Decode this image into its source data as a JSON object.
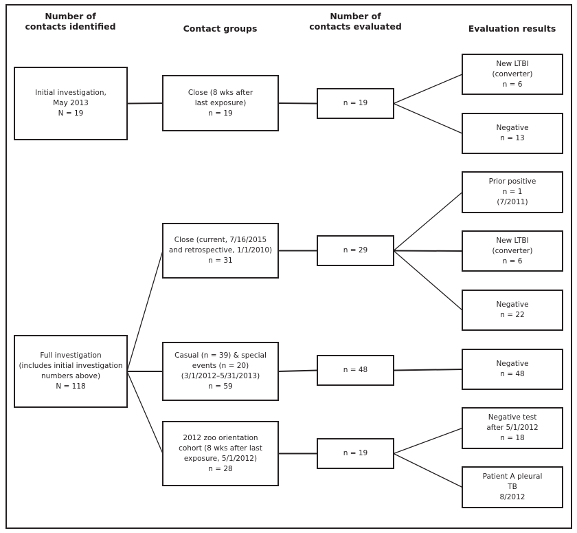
{
  "headers": {
    "identified": "Number of\ncontacts identified",
    "groups": "Contact groups",
    "evaluated": "Number of\ncontacts evaluated",
    "results": "Evaluation results"
  },
  "identified": [
    {
      "id": "initial",
      "text": "Initial investigation,\nMay 2013\nN = 19"
    },
    {
      "id": "full",
      "text": "Full investigation\n(includes initial investigation\nnumbers above)\nN = 118"
    }
  ],
  "groups": [
    {
      "id": "close-initial",
      "text": "Close (8 wks after\nlast exposure)\nn = 19"
    },
    {
      "id": "close-full",
      "text": "Close (current, 7/16/2015\nand retrospective, 1/1/2010)\nn = 31"
    },
    {
      "id": "casual",
      "text": "Casual (n = 39) & special\nevents (n = 20)\n(3/1/2012–5/31/2013)\nn = 59"
    },
    {
      "id": "zoo-cohort",
      "text": "2012 zoo orientation\ncohort (8 wks after last\nexposure, 5/1/2012)\nn = 28"
    }
  ],
  "evaluated": [
    {
      "id": "eval-close-initial",
      "text": "n = 19"
    },
    {
      "id": "eval-close-full",
      "text": "n = 29"
    },
    {
      "id": "eval-casual",
      "text": "n = 48"
    },
    {
      "id": "eval-zoo",
      "text": "n = 19"
    }
  ],
  "results": [
    {
      "id": "r1",
      "text": "New LTBI\n(converter)\nn = 6"
    },
    {
      "id": "r2",
      "text": "Negative\nn = 13"
    },
    {
      "id": "r3",
      "text": "Prior positive\nn = 1\n(7/2011)"
    },
    {
      "id": "r4",
      "text": "New LTBI\n(converter)\nn = 6"
    },
    {
      "id": "r5",
      "text": "Negative\nn = 22"
    },
    {
      "id": "r6",
      "text": "Negative\nn = 48"
    },
    {
      "id": "r7",
      "text": "Negative test\nafter 5/1/2012\nn = 18"
    },
    {
      "id": "r8",
      "text": "Patient A pleural\nTB\n8/2012"
    }
  ],
  "edges": [
    [
      "initial",
      "close-initial"
    ],
    [
      "full",
      "close-full"
    ],
    [
      "full",
      "casual"
    ],
    [
      "full",
      "zoo-cohort"
    ],
    [
      "close-initial",
      "eval-close-initial"
    ],
    [
      "close-full",
      "eval-close-full"
    ],
    [
      "casual",
      "eval-casual"
    ],
    [
      "zoo-cohort",
      "eval-zoo"
    ],
    [
      "eval-close-initial",
      "r1"
    ],
    [
      "eval-close-initial",
      "r2"
    ],
    [
      "eval-close-full",
      "r3"
    ],
    [
      "eval-close-full",
      "r4"
    ],
    [
      "eval-close-full",
      "r5"
    ],
    [
      "eval-casual",
      "r6"
    ],
    [
      "eval-zoo",
      "r7"
    ],
    [
      "eval-zoo",
      "r8"
    ]
  ]
}
